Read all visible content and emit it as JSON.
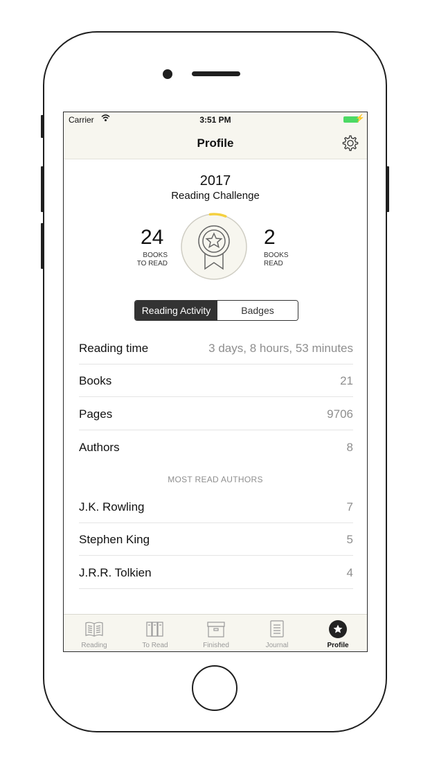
{
  "status_bar": {
    "carrier": "Carrier",
    "time": "3:51 PM",
    "battery_color": "#4cd964"
  },
  "nav": {
    "title": "Profile"
  },
  "challenge": {
    "year": "2017",
    "label": "Reading Challenge",
    "to_read_count": "24",
    "to_read_caption_1": "BOOKS",
    "to_read_caption_2": "TO READ",
    "read_count": "2",
    "read_caption_1": "BOOKS",
    "read_caption_2": "READ",
    "progress_fraction": 0.077,
    "progress_color": "#f4d03f"
  },
  "segmented": {
    "active": "Reading Activity",
    "inactive": "Badges"
  },
  "stats": [
    {
      "label": "Reading time",
      "value": "3 days, 8 hours, 53 minutes"
    },
    {
      "label": "Books",
      "value": "21"
    },
    {
      "label": "Pages",
      "value": "9706"
    },
    {
      "label": "Authors",
      "value": "8"
    }
  ],
  "most_read_header": "MOST READ AUTHORS",
  "authors": [
    {
      "name": "J.K. Rowling",
      "count": "7"
    },
    {
      "name": "Stephen King",
      "count": "5"
    },
    {
      "name": "J.R.R. Tolkien",
      "count": "4"
    }
  ],
  "tabs": [
    {
      "label": "Reading",
      "icon": "open-book-icon"
    },
    {
      "label": "To Read",
      "icon": "books-stack-icon"
    },
    {
      "label": "Finished",
      "icon": "archive-box-icon"
    },
    {
      "label": "Journal",
      "icon": "journal-icon"
    },
    {
      "label": "Profile",
      "icon": "profile-star-icon"
    }
  ]
}
